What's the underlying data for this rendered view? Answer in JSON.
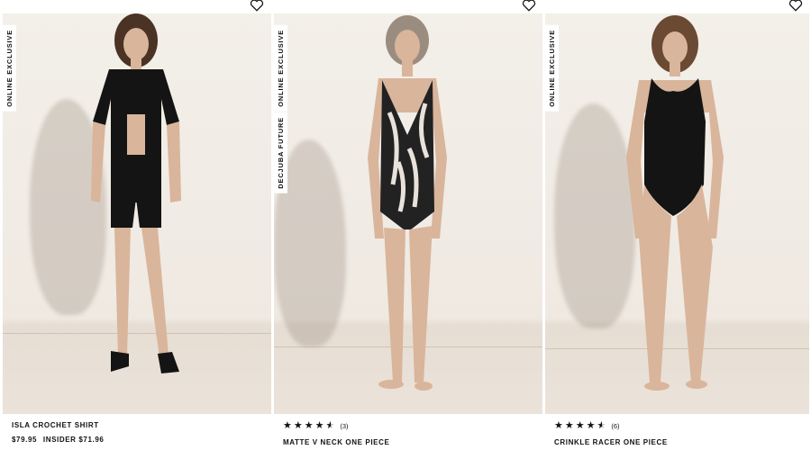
{
  "products": [
    {
      "badges": [
        "ONLINE EXCLUSIVE"
      ],
      "name": "ISLA CROCHET SHIRT",
      "price": "$79.95",
      "insider_price": "INSIDER $71.96",
      "rating": null,
      "review_count": null
    },
    {
      "badges": [
        "ONLINE EXCLUSIVE",
        "DECJUBA FUTURE"
      ],
      "name": "MATTE V NECK ONE PIECE",
      "rating": 4.5,
      "review_count": "(3)"
    },
    {
      "badges": [
        "ONLINE EXCLUSIVE"
      ],
      "name": "CRINKLE RACER ONE PIECE",
      "rating": 4.5,
      "review_count": "(6)"
    }
  ],
  "icons": {
    "wishlist": "heart-outline-icon",
    "star_full": "★",
    "star_half": "★"
  },
  "colors": {
    "text": "#111111",
    "background": "#ffffff",
    "photo_backdrop": "#efe9e2"
  }
}
